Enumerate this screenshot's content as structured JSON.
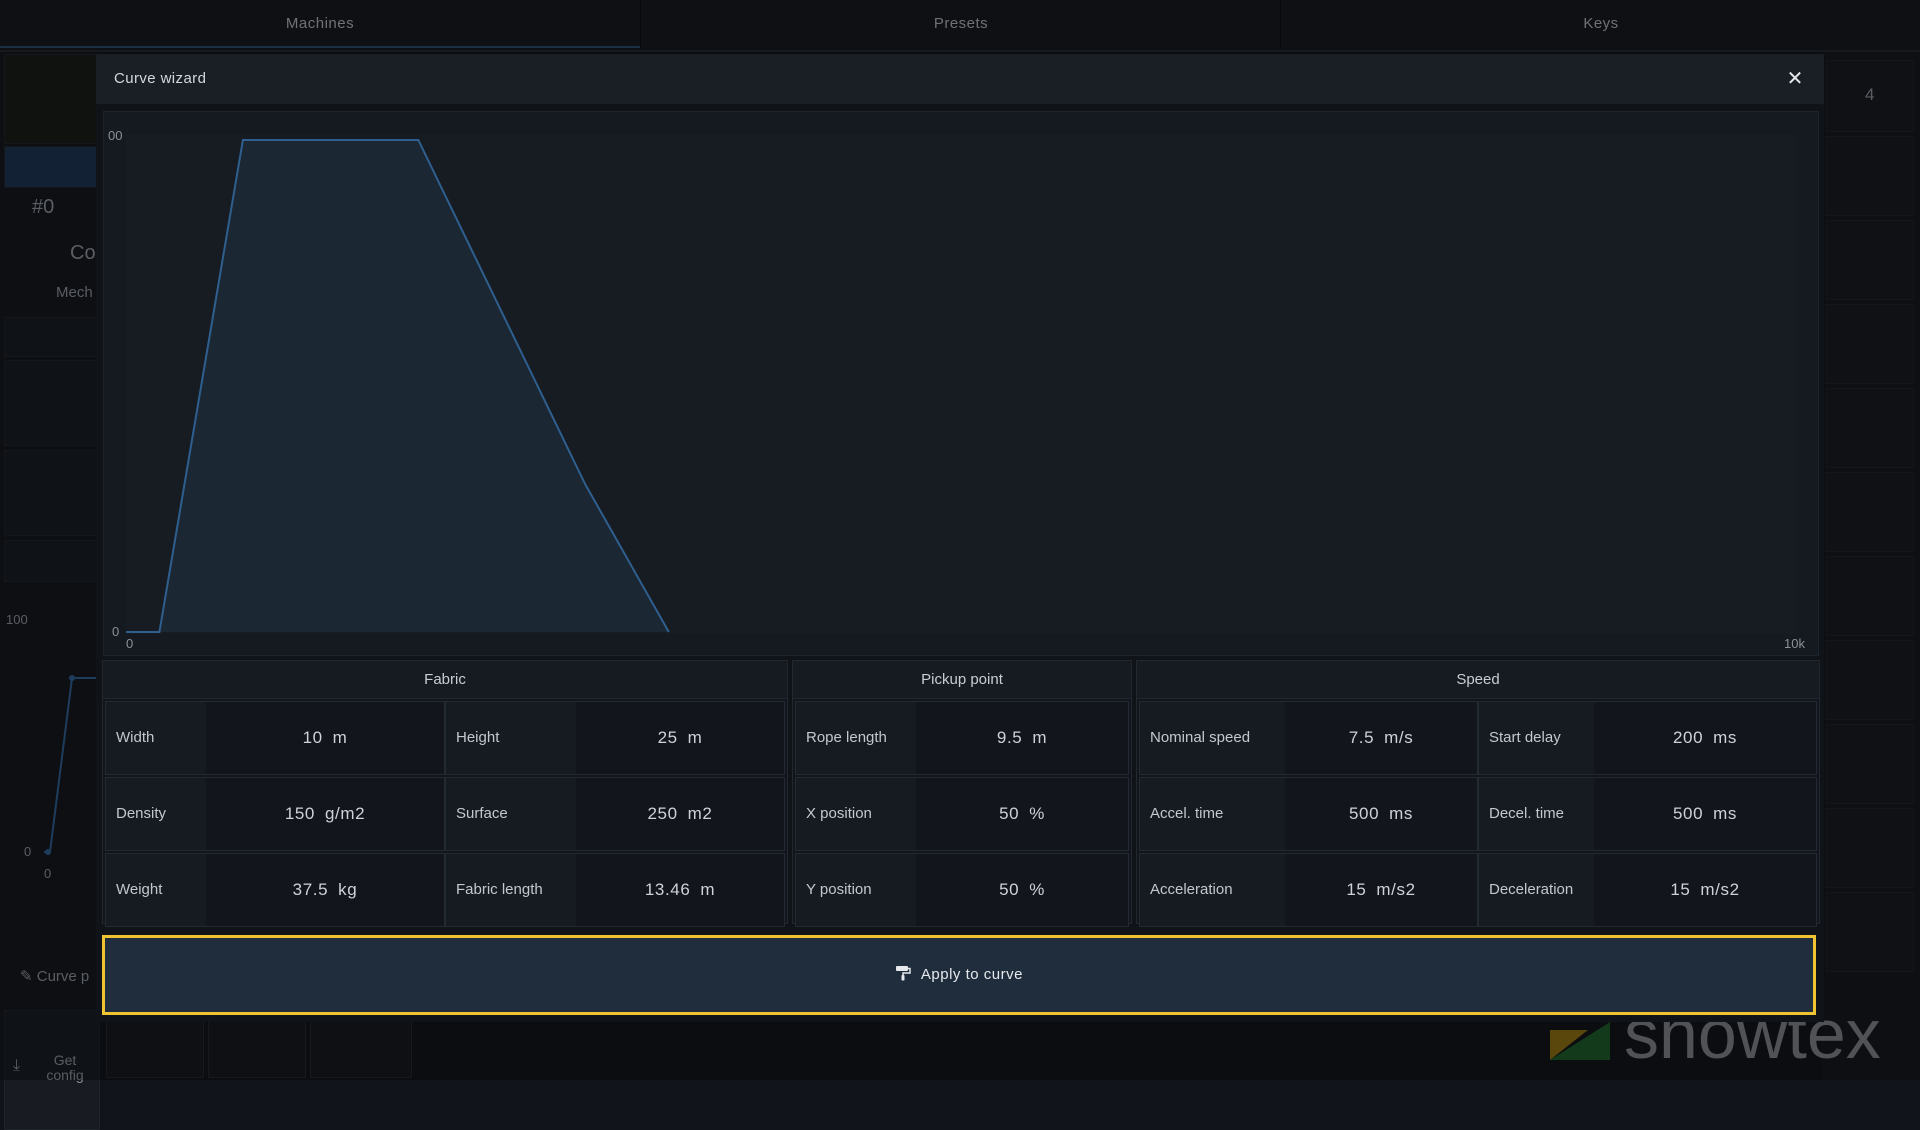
{
  "topbar": {
    "tabs": [
      "Machines",
      "Presets",
      "Keys"
    ]
  },
  "background": {
    "left": {
      "id": "#0",
      "short1": "Co",
      "short2": "Mech",
      "mini_chart": {
        "y_top": "100",
        "y_bottom": "0",
        "x_start": "0"
      },
      "curve_label": "Curve p",
      "get_config": "Get config"
    },
    "right": {
      "number": "4"
    },
    "logo_text": "showtex"
  },
  "modal": {
    "title": "Curve wizard",
    "close_icon": "close-icon",
    "apply_label": "Apply to curve",
    "apply_icon": "paint-roller-icon"
  },
  "chart_data": {
    "type": "area",
    "x_tick_labels": [
      "0",
      "10k"
    ],
    "y_tick_labels": [
      "0",
      "00"
    ],
    "xlim": [
      0,
      10000
    ],
    "ylim": [
      0,
      100
    ],
    "x": [
      0,
      200,
      700,
      1750,
      2750,
      3250
    ],
    "values": [
      0,
      0,
      100,
      100,
      30,
      0
    ],
    "line_color": "#2f5f8e",
    "fill_color": "#1b2733",
    "grid": false
  },
  "groups": {
    "fabric": {
      "title": "Fabric",
      "rows": [
        [
          {
            "label": "Width",
            "value": "10",
            "unit": "m"
          },
          {
            "label": "Height",
            "value": "25",
            "unit": "m"
          }
        ],
        [
          {
            "label": "Density",
            "value": "150",
            "unit": "g/m2"
          },
          {
            "label": "Surface",
            "value": "250",
            "unit": "m2"
          }
        ],
        [
          {
            "label": "Weight",
            "value": "37.5",
            "unit": "kg"
          },
          {
            "label": "Fabric length",
            "value": "13.46",
            "unit": "m"
          }
        ]
      ]
    },
    "pickup": {
      "title": "Pickup point",
      "rows": [
        {
          "label": "Rope length",
          "value": "9.5",
          "unit": "m"
        },
        {
          "label": "X position",
          "value": "50",
          "unit": "%"
        },
        {
          "label": "Y position",
          "value": "50",
          "unit": "%"
        }
      ]
    },
    "speed": {
      "title": "Speed",
      "rows": [
        [
          {
            "label": "Nominal speed",
            "value": "7.5",
            "unit": "m/s"
          },
          {
            "label": "Start delay",
            "value": "200",
            "unit": "ms"
          }
        ],
        [
          {
            "label": "Accel. time",
            "value": "500",
            "unit": "ms"
          },
          {
            "label": "Decel. time",
            "value": "500",
            "unit": "ms"
          }
        ],
        [
          {
            "label": "Acceleration",
            "value": "15",
            "unit": "m/s2"
          },
          {
            "label": "Deceleration",
            "value": "15",
            "unit": "m/s2"
          }
        ]
      ]
    }
  }
}
